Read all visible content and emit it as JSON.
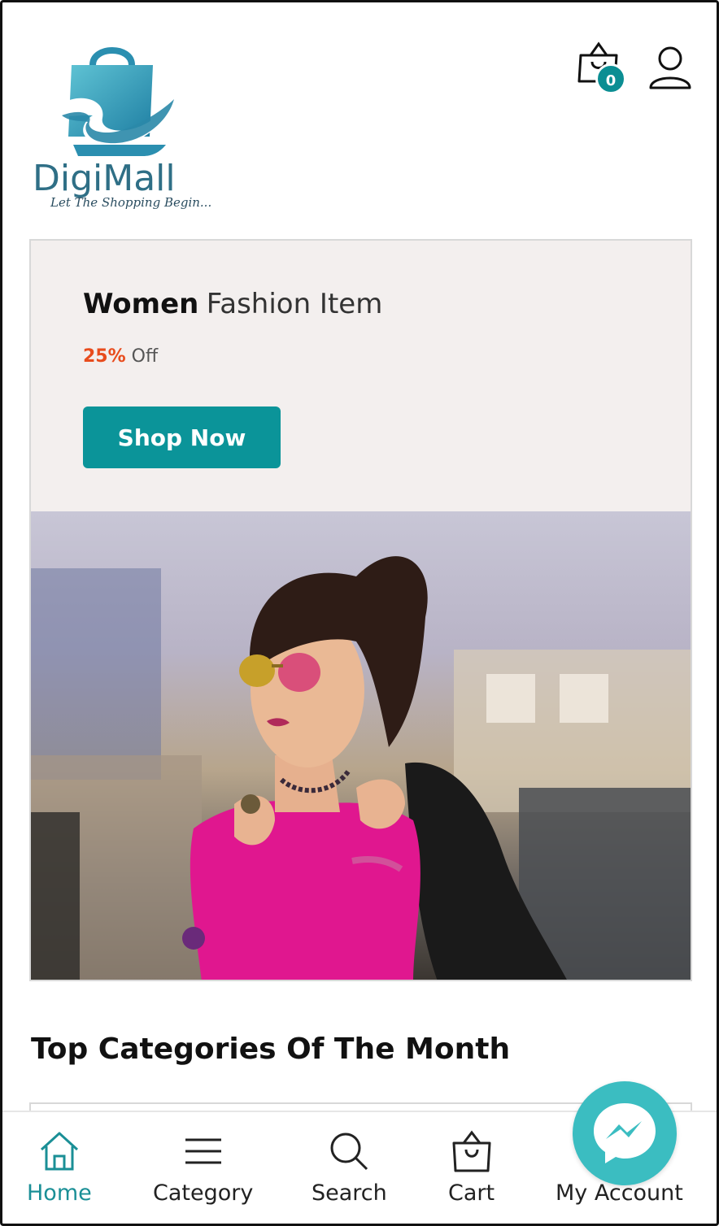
{
  "header": {
    "logo": {
      "name": "DigiMall",
      "tagline": "Let The Shopping Begin..."
    },
    "cart_count": "0"
  },
  "banner": {
    "title_bold": "Women",
    "title_rest": "Fashion Item",
    "discount_pct": "25%",
    "discount_suffix": "Off",
    "cta_label": "Shop Now"
  },
  "section": {
    "title": "Top Categories Of The Month"
  },
  "bottom_nav": {
    "items": [
      {
        "label": "Home",
        "icon": "home-icon",
        "active": true
      },
      {
        "label": "Category",
        "icon": "menu-icon"
      },
      {
        "label": "Search",
        "icon": "search-icon"
      },
      {
        "label": "Cart",
        "icon": "shopping-bag-icon"
      },
      {
        "label": "My Account",
        "icon": "user-icon"
      }
    ]
  },
  "colors": {
    "accent": "#0b9499",
    "discount": "#e84c1d",
    "active_nav": "#1a8f96",
    "messenger": "#3bbdc1"
  }
}
